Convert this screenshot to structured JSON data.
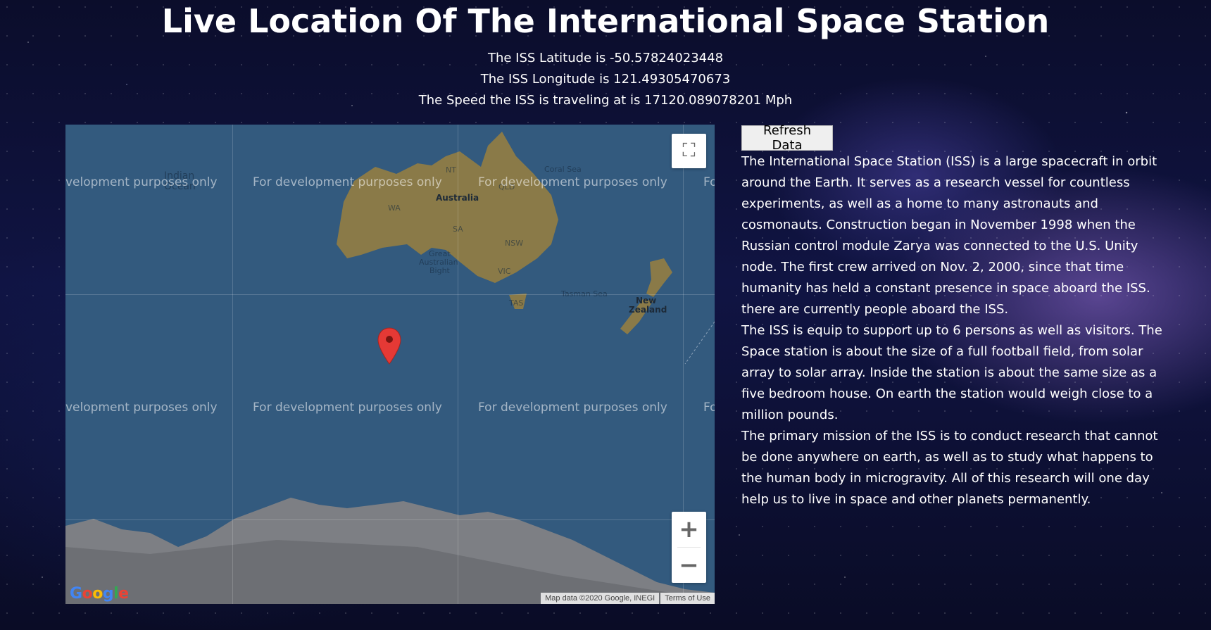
{
  "page": {
    "title": "Live Location Of The International Space Station",
    "latitude_text": "The ISS Latitude is -50.57824023448",
    "longitude_text": "The ISS Longitude is 121.49305470673",
    "speed_text": "The Speed the ISS is traveling at is 17120.089078201 Mph"
  },
  "map": {
    "watermark": "For development purposes only",
    "watermark_cut_left": "velopment purposes only",
    "watermark_cut_right": "Fo",
    "labels": {
      "indian_ocean_1": "Indian",
      "indian_ocean_2": "Ocean",
      "australia": "Australia",
      "nt": "NT",
      "wa": "WA",
      "sa": "SA",
      "qld": "QLD",
      "nsw": "NSW",
      "vic": "VIC",
      "tas": "TAS",
      "coral_sea": "Coral Sea",
      "tasman_sea": "Tasman Sea",
      "new_zealand_1": "New",
      "new_zealand_2": "Zealand",
      "great_bight_1": "Great",
      "great_bight_2": "Australian",
      "great_bight_3": "Bight"
    },
    "zoom_in": "+",
    "zoom_out": "−",
    "fullscreen_icon": "⛶",
    "logo": "Google",
    "attribution": "Map data ©2020 Google, INEGI",
    "terms": "Terms of Use"
  },
  "refresh_button": "Refresh Data",
  "description": [
    "The International Space Station (ISS) is a large spacecraft in orbit around the Earth. It serves as a research vessel for countless experiments, as well as a home to many astronauts and cosmonauts. Construction began in November 1998 when the Russian control module Zarya was connected to the U.S. Unity node. The first crew arrived on Nov. 2, 2000, since that time humanity has held a constant presence in space aboard the ISS.",
    "there are currently people aboard the ISS.",
    "The ISS is equip to support up to 6 persons as well as visitors. The Space station is about the size of a full football field, from solar array to solar array. Inside the station is about the same size as a five bedroom house. On earth the station would weigh close to a million pounds.",
    "The primary mission of the ISS is to conduct research that cannot be done anywhere on earth, as well as to study what happens to the human body in microgravity. All of this research will one day help us to live in space and other planets permanently."
  ],
  "colors": {
    "ocean": "#335a7e",
    "land": "#8a7a48",
    "antarctica": "#7d7f84",
    "marker": "#e53935"
  }
}
